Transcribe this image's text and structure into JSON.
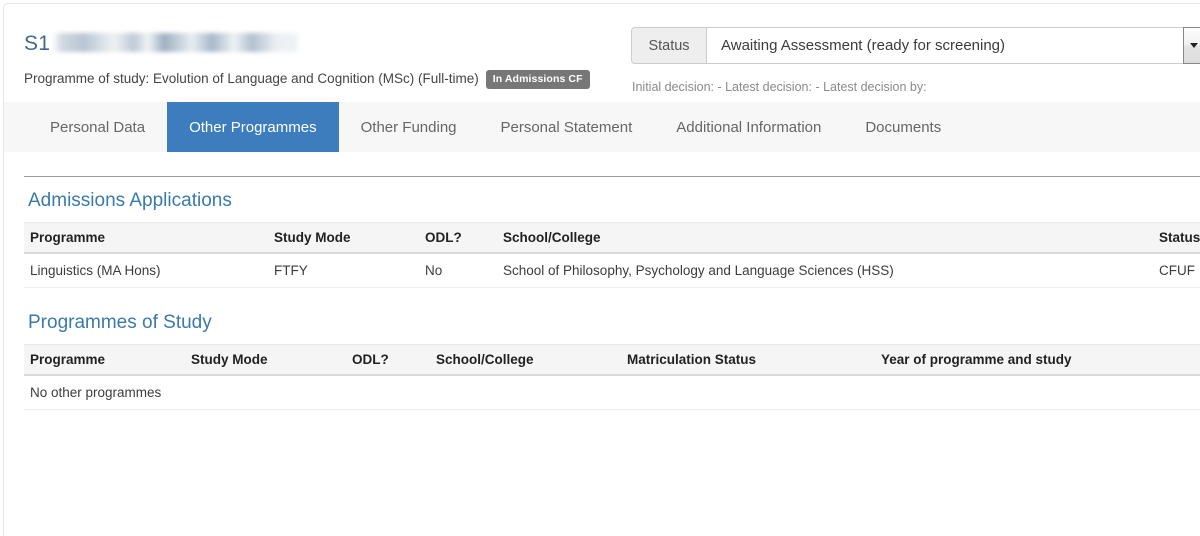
{
  "header": {
    "student_id_prefix": "S1",
    "student_name_redacted": true,
    "programme_of_study_label": "Programme of study: Evolution of Language and Cognition (MSc) (Full-time)",
    "admissions_badge": "In Admissions CF",
    "status": {
      "addon_label": "Status",
      "selected_value": "Awaiting Assessment (ready for screening)",
      "dropdown_icon": "chevron-down-icon"
    },
    "decision_summary": "Initial decision: - Latest decision: - Latest decision by:"
  },
  "tabs": [
    {
      "label": "Personal Data",
      "active": false
    },
    {
      "label": "Other Programmes",
      "active": true
    },
    {
      "label": "Other Funding",
      "active": false
    },
    {
      "label": "Personal Statement",
      "active": false
    },
    {
      "label": "Additional Information",
      "active": false
    },
    {
      "label": "Documents",
      "active": false
    }
  ],
  "sections": {
    "admissions_applications": {
      "title": "Admissions Applications",
      "columns": [
        "Programme",
        "Study Mode",
        "ODL?",
        "School/College",
        "Status"
      ],
      "rows": [
        {
          "programme": "Linguistics (MA Hons)",
          "study_mode": "FTFY",
          "odl": "No",
          "school_college": "School of Philosophy, Psychology and Language Sciences (HSS)",
          "status": "CFUF"
        }
      ]
    },
    "programmes_of_study": {
      "title": "Programmes of Study",
      "columns": [
        "Programme",
        "Study Mode",
        "ODL?",
        "School/College",
        "Matriculation Status",
        "Year of programme and study"
      ],
      "empty_message": "No other programmes",
      "rows": []
    }
  },
  "colors": {
    "accent_blue": "#3d7dbe",
    "heading_blue": "#3a7aad",
    "badge_grey": "#777777",
    "tabbar_bg": "#f7f7f7",
    "table_header_bg": "#f5f5f5"
  }
}
